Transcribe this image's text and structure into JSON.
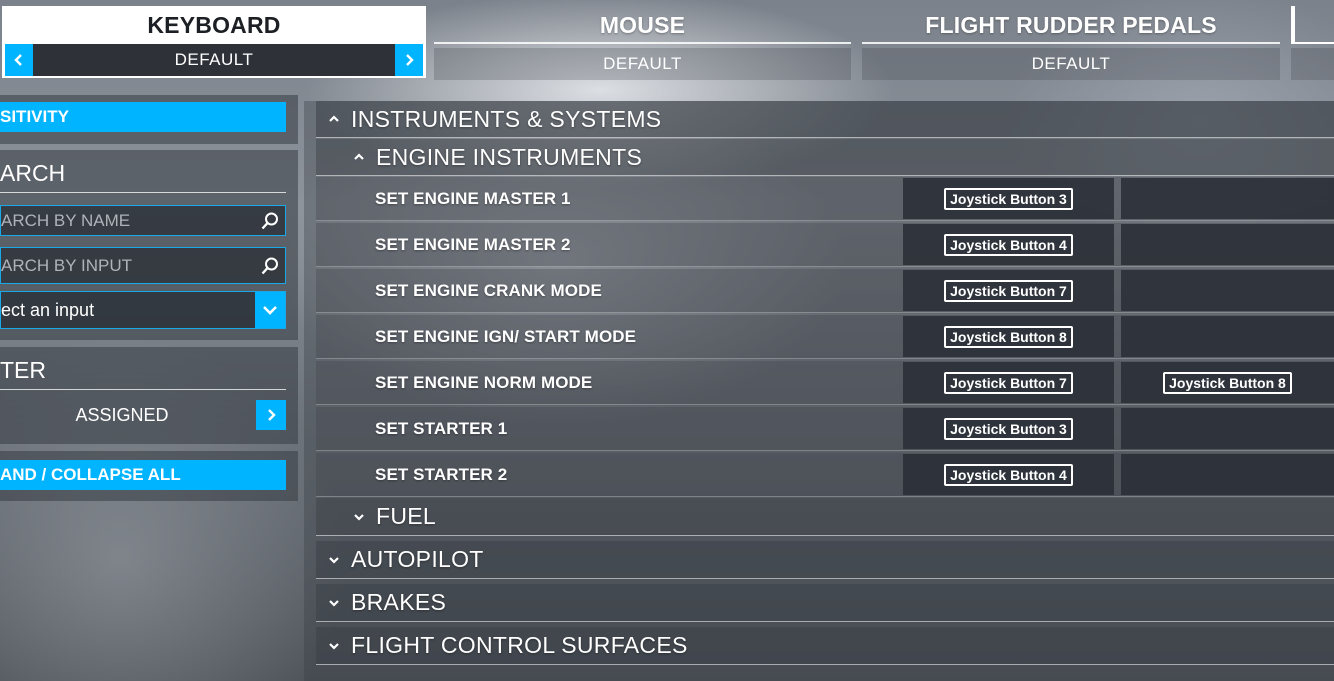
{
  "device_tabs": [
    {
      "title": "KEYBOARD",
      "profile": "DEFAULT"
    },
    {
      "title": "MOUSE",
      "profile": "DEFAULT"
    },
    {
      "title": "FLIGHT RUDDER PEDALS",
      "profile": "DEFAULT"
    }
  ],
  "left_panel": {
    "sensitivity_label": "SITIVITY",
    "search_heading": "ARCH",
    "search_by_name_placeholder": "ARCH BY NAME",
    "search_by_input_placeholder": "ARCH BY INPUT",
    "select_input_value": "ect an input",
    "filter_heading": "TER",
    "filter_value": "ASSIGNED",
    "expand_collapse_label": "AND / COLLAPSE ALL"
  },
  "main": {
    "instruments_category": "INSTRUMENTS & SYSTEMS",
    "engine_instruments_subcategory": "ENGINE INSTRUMENTS",
    "bindings": [
      {
        "name": "SET ENGINE MASTER 1",
        "input1": "Joystick Button 3",
        "input2": ""
      },
      {
        "name": "SET ENGINE MASTER 2",
        "input1": "Joystick Button 4",
        "input2": ""
      },
      {
        "name": "SET ENGINE CRANK MODE",
        "input1": "Joystick Button 7",
        "input2": ""
      },
      {
        "name": "SET ENGINE IGN/ START MODE",
        "input1": "Joystick Button 8",
        "input2": ""
      },
      {
        "name": "SET ENGINE NORM MODE",
        "input1": "Joystick Button 7",
        "input2": "Joystick Button 8"
      },
      {
        "name": "SET STARTER 1",
        "input1": "Joystick Button 3",
        "input2": ""
      },
      {
        "name": "SET STARTER 2",
        "input1": "Joystick Button 4",
        "input2": ""
      }
    ],
    "fuel_subcategory": "FUEL",
    "categories_collapsed": [
      "AUTOPILOT",
      "BRAKES",
      "FLIGHT CONTROL SURFACES"
    ]
  },
  "colors": {
    "accent": "#00b4ff",
    "panel_dark": "#2e3238"
  },
  "icons": {
    "left_arrow": "chevron-left-icon",
    "right_arrow": "chevron-right-icon",
    "search": "search-icon",
    "dropdown": "chevron-down-icon",
    "expanded": "chevron-up-icon",
    "collapsed": "chevron-down-icon"
  }
}
